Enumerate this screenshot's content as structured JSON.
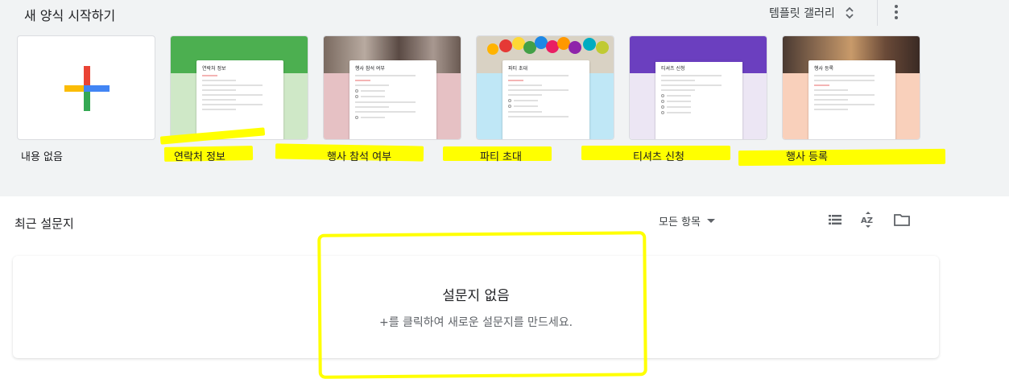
{
  "header": {
    "title": "새 양식 시작하기",
    "gallery_label": "템플릿 갤러리"
  },
  "templates": [
    {
      "label": "내용 없음"
    },
    {
      "label": "연락처 정보",
      "form_title": "연락처 정보"
    },
    {
      "label": "행사 참석 여부",
      "form_title": "행사 참석 여부"
    },
    {
      "label": "파티 초대",
      "form_title": "파티 초대"
    },
    {
      "label": "티셔츠 신청",
      "form_title": "티셔츠 신청"
    },
    {
      "label": "행사 등록",
      "form_title": "행사 등록"
    }
  ],
  "recent": {
    "title": "최근 설문지",
    "filter_label": "모든 항목",
    "empty_title": "설문지 없음",
    "empty_subtitle": "+를 클릭하여 새로운 설문지를 만드세요."
  },
  "colors": {
    "background": "#f1f3f4",
    "highlight": "#ffff00",
    "contact_band": "#4caf50",
    "contact_lower": "#cfe8c7",
    "rsvp_lower": "#e6c1c4",
    "party_lower": "#bfe7f6",
    "tshirt_band": "#6b3fbf",
    "tshirt_lower": "#ece6f4",
    "event_lower": "#f9d0bb"
  },
  "icons": {
    "blank": "plus-icon",
    "gallery": "unfold-more-icon",
    "menu": "more-vert-icon",
    "filter": "arrow-drop-down-icon",
    "list_view": "list-view-icon",
    "sort": "sort-az-icon",
    "folder": "folder-icon"
  }
}
